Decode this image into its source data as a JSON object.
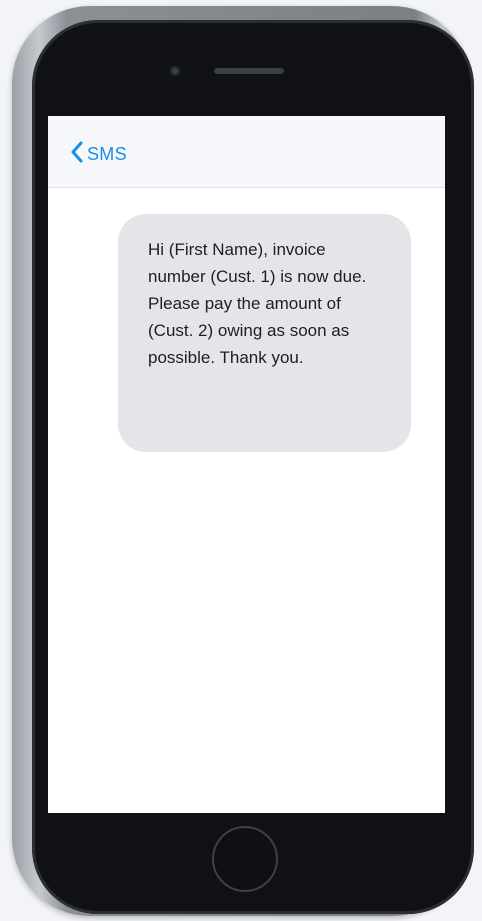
{
  "nav": {
    "back_label": "SMS"
  },
  "message": {
    "text": "Hi (First Name), invoice number (Cust. 1) is now due. Please pay the amount of (Cust. 2) owing as soon as possible. Thank you."
  },
  "colors": {
    "accent": "#1b8ee8",
    "bubble": "#e4e4e9",
    "phone_frame": "#101114"
  },
  "icons": {
    "back": "chevron-left-icon"
  }
}
